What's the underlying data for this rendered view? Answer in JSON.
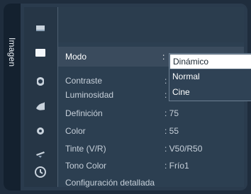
{
  "side_tab": {
    "label": "Imagen"
  },
  "menu": {
    "items": [
      {
        "label": "Modo",
        "value": ":"
      },
      {
        "label": "Contraste",
        "value": ":"
      },
      {
        "label": "Luminosidad",
        "value": ":"
      },
      {
        "label": "Definición",
        "value": ": 75"
      },
      {
        "label": "Color",
        "value": ": 55"
      },
      {
        "label": "Tinte (V/R)",
        "value": ": V50/R50"
      },
      {
        "label": "Tono Color",
        "value": ": Frío1"
      },
      {
        "label": "Configuración detallada",
        "value": ""
      }
    ]
  },
  "dropdown": {
    "options": [
      "Dinámico",
      "Normal",
      "Cine"
    ],
    "selected": "Dinámico"
  },
  "icons": [
    "input-icon",
    "picture-icon",
    "sound-icon",
    "channel-icon",
    "setup-icon",
    "plugin-icon",
    "clock-icon"
  ],
  "colors": {
    "background": "#2c3f51",
    "highlight": "#3a4b5d",
    "text": "#c7d0da",
    "active_text": "#ffffff"
  }
}
